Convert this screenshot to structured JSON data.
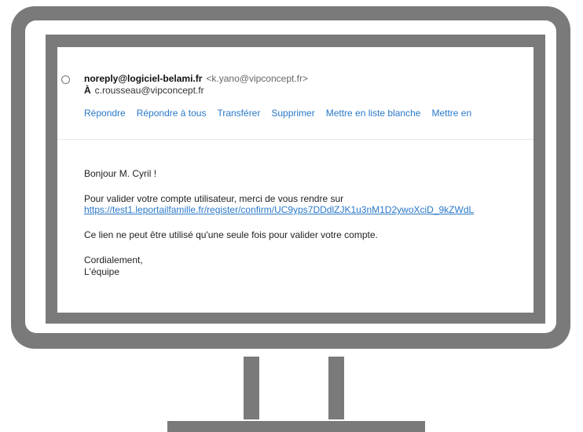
{
  "email": {
    "from_name": "noreply@logiciel-belami.fr",
    "from_address": "<k.yano@vipconcept.fr>",
    "to_label": "À",
    "to_address": "c.rousseau@vipconcept.fr",
    "actions": [
      "Répondre",
      "Répondre à tous",
      "Transférer",
      "Supprimer",
      "Mettre en liste blanche",
      "Mettre en"
    ],
    "greeting": "Bonjour M. Cyril !",
    "paragraph1": "Pour valider votre compte utilisateur, merci de vous rendre sur",
    "link_text": "https://test1.leportailfamille.fr/register/confirm/UC9yps7DDdlZJK1u3nM1D2ywoXciD_9kZWdL",
    "paragraph2": "Ce lien ne peut être utilisé qu'une seule fois pour valider votre compte.",
    "closing": "Cordialement,",
    "signature": "L'équipe"
  },
  "colors": {
    "frame": "#7a7a7a",
    "link": "#2a78c8"
  },
  "icons": {
    "select": "circle-radio-icon",
    "monitor": "monitor-icon"
  }
}
